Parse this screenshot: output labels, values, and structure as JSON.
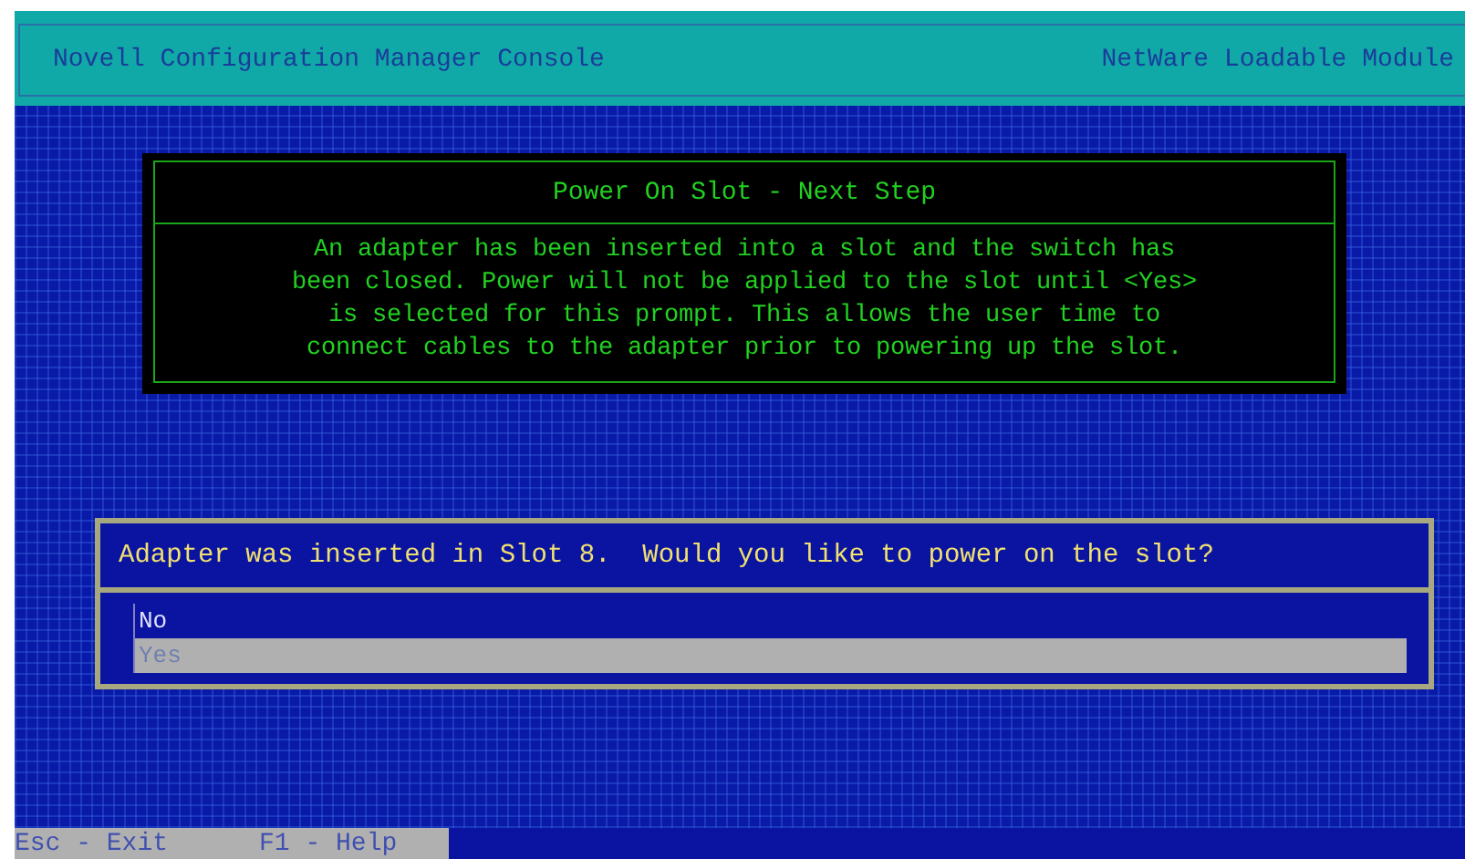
{
  "header": {
    "title": "Novell Configuration Manager Console",
    "module": "NetWare Loadable Module"
  },
  "info_dialog": {
    "title": "Power On Slot - Next Step",
    "message_lines": [
      "An adapter has been inserted into a slot and the switch has",
      "been closed. Power will not be applied to the slot until <Yes>",
      "is selected for this prompt. This allows the user time to",
      "connect cables to the adapter prior to powering up the slot."
    ]
  },
  "prompt": {
    "question": "Adapter was inserted in Slot 8.  Would you like to power on the slot?",
    "options": [
      {
        "label": "No",
        "selected": false
      },
      {
        "label": "Yes",
        "selected": true
      }
    ]
  },
  "status_bar": [
    "Esc - Exit",
    "F1 - Help"
  ]
}
